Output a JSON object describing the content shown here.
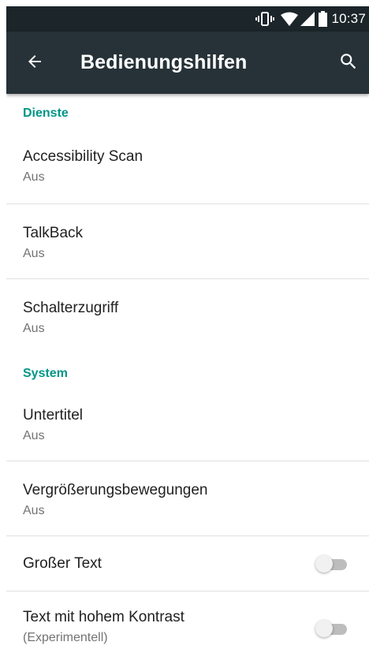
{
  "status_bar": {
    "time": "10:37",
    "icons": [
      "vibrate-icon",
      "wifi-icon",
      "signal-icon",
      "battery-icon"
    ]
  },
  "app_bar": {
    "title": "Bedienungshilfen",
    "back_icon": "arrow-back-icon",
    "search_icon": "search-icon"
  },
  "colors": {
    "status_bar": "#1b252a",
    "app_bar": "#263238",
    "accent": "#009688",
    "toggle_off_track": "#bdbdbd",
    "toggle_off_thumb": "#f1f1f1"
  },
  "sections": [
    {
      "header": "Dienste",
      "items": [
        {
          "title": "Accessibility Scan",
          "summary": "Aus"
        },
        {
          "title": "TalkBack",
          "summary": "Aus"
        },
        {
          "title": "Schalterzugriff",
          "summary": "Aus"
        }
      ]
    },
    {
      "header": "System",
      "items": [
        {
          "title": "Untertitel",
          "summary": "Aus"
        },
        {
          "title": "Vergrößerungsbewegungen",
          "summary": "Aus"
        },
        {
          "title": "Großer Text",
          "toggle": false
        },
        {
          "title": "Text mit hohem Kontrast",
          "summary": "(Experimentell)",
          "toggle": false
        }
      ]
    }
  ]
}
